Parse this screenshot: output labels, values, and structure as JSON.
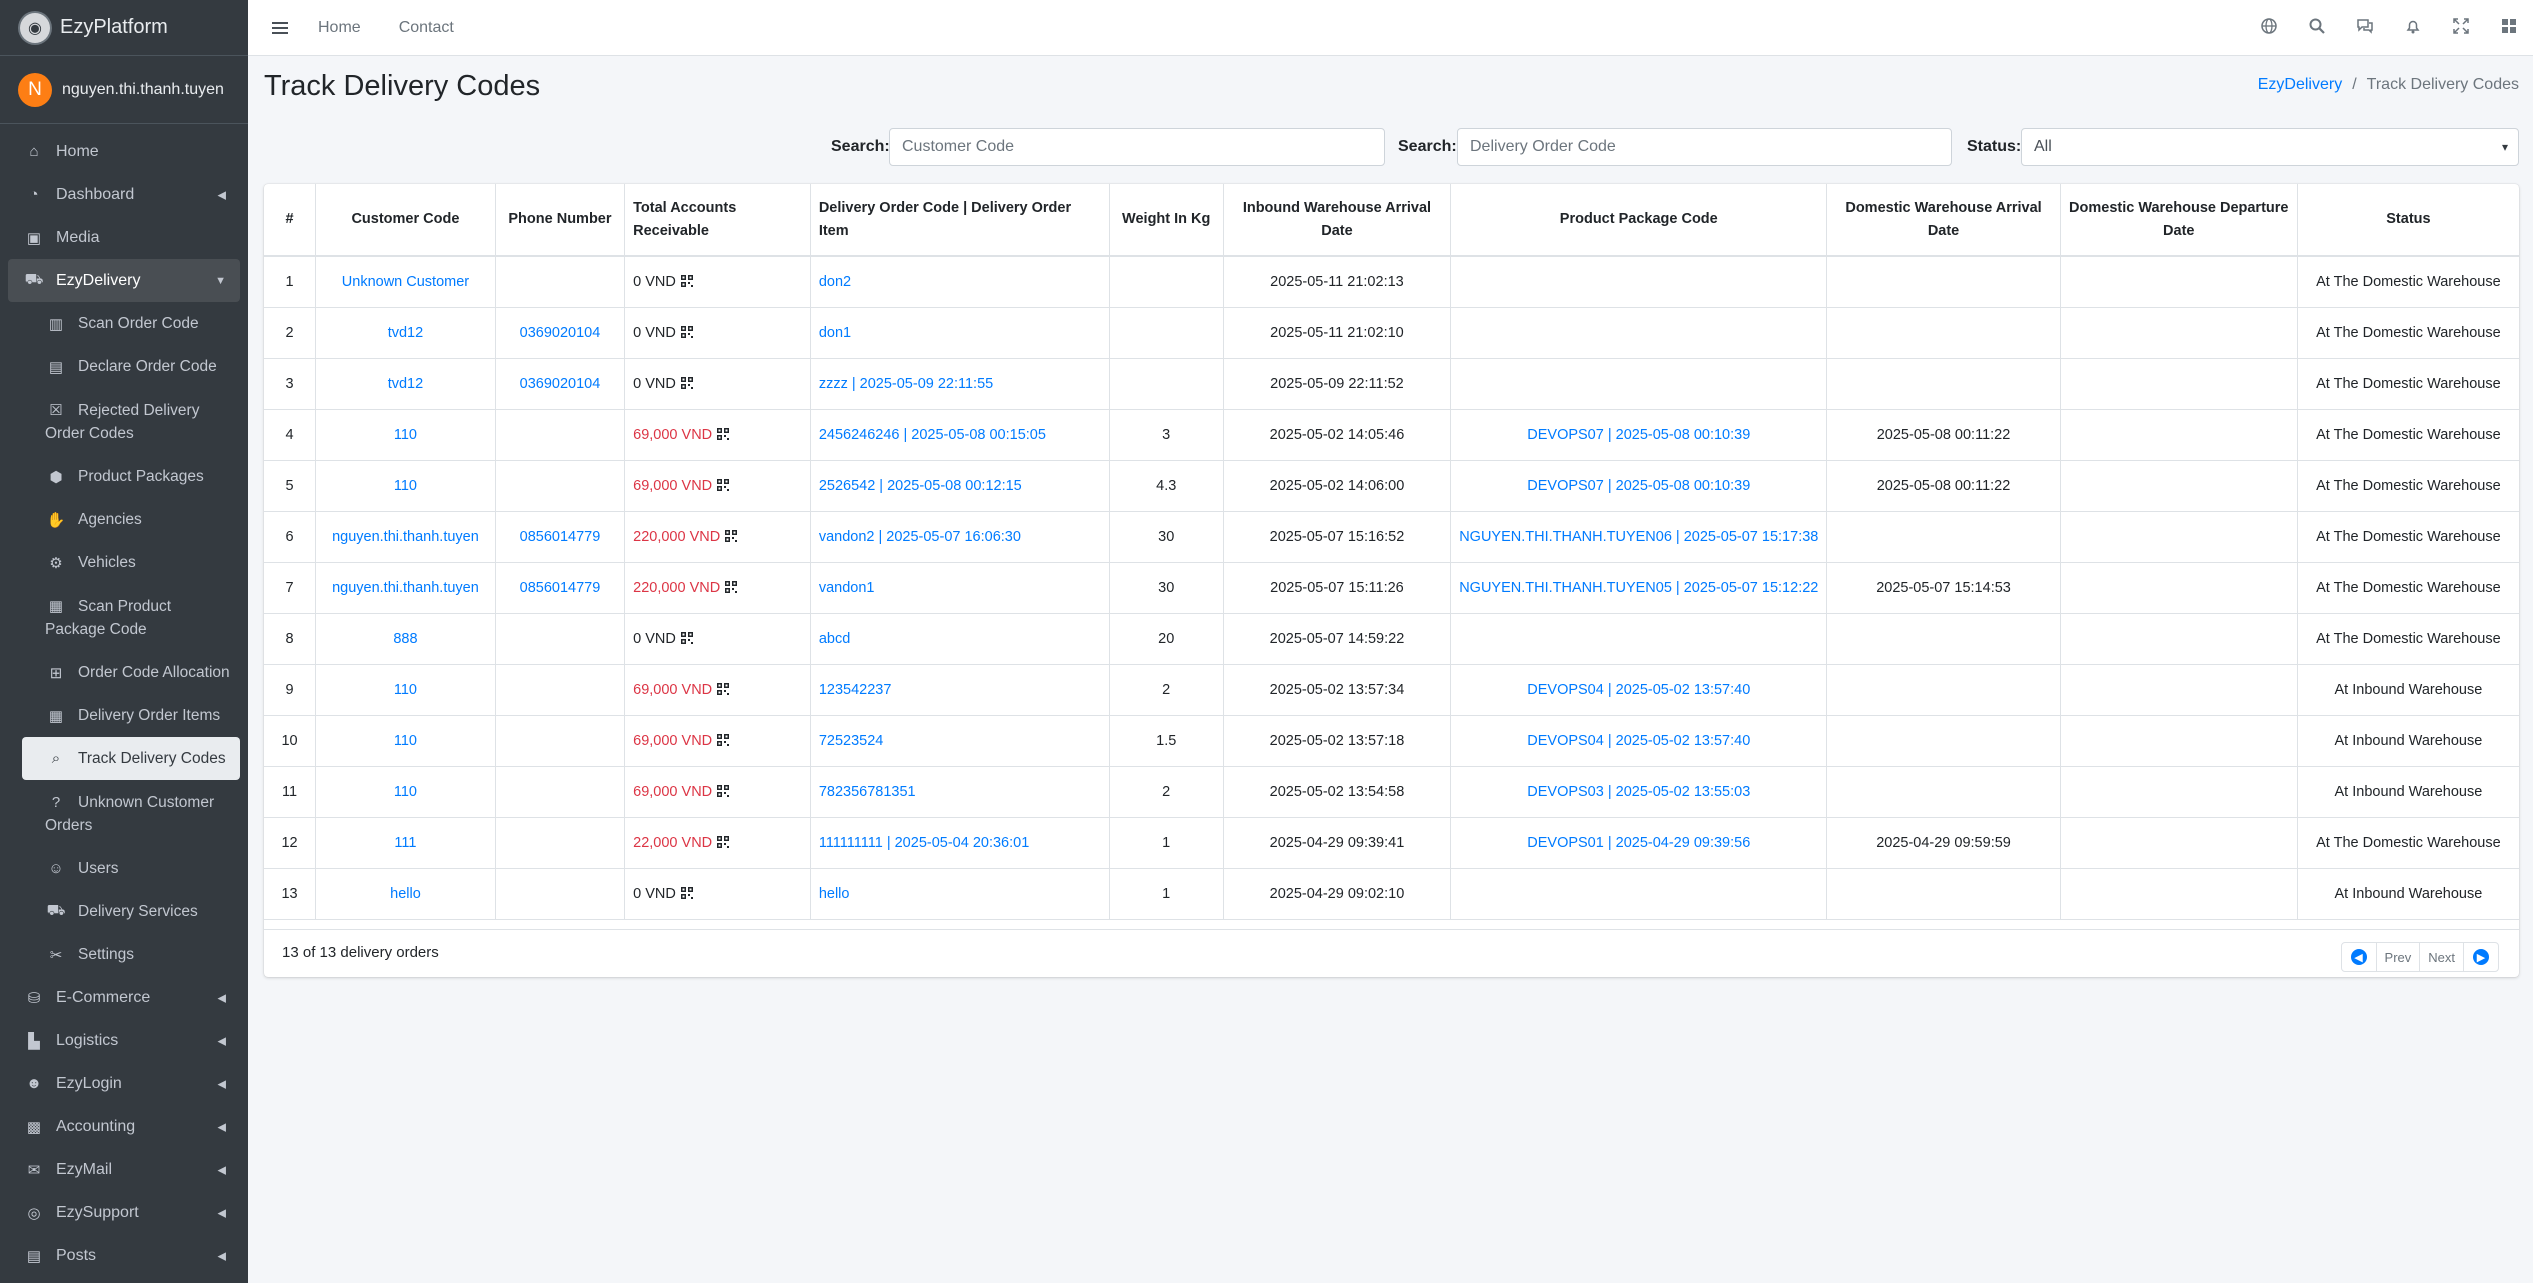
{
  "brand": {
    "name": "EzyPlatform"
  },
  "user": {
    "initial": "N",
    "name": "nguyen.thi.thanh.tuyen"
  },
  "sidebar": {
    "items_top": [
      {
        "label": "Home",
        "icon": "home-icon"
      },
      {
        "label": "Dashboard",
        "icon": "dashboard-icon"
      },
      {
        "label": "Media",
        "icon": "image-icon"
      },
      {
        "label": "EzyDelivery",
        "icon": "truck-icon"
      }
    ],
    "sub_items": [
      {
        "label": "Scan Order Code",
        "icon": "barcode-icon"
      },
      {
        "label": "Declare Order Code",
        "icon": "file-icon"
      },
      {
        "label": "Rejected Delivery Order Codes",
        "icon": "x-square-icon"
      },
      {
        "label": "Product Packages",
        "icon": "boxes-icon"
      },
      {
        "label": "Agencies",
        "icon": "handshake-icon"
      },
      {
        "label": "Vehicles",
        "icon": "motorcycle-icon"
      },
      {
        "label": "Scan Product Package Code",
        "icon": "qrcode-icon"
      },
      {
        "label": "Order Code Allocation",
        "icon": "sitemap-icon"
      },
      {
        "label": "Delivery Order Items",
        "icon": "grid-icon"
      },
      {
        "label": "Track Delivery Codes",
        "icon": "search-icon"
      },
      {
        "label": "Unknown Customer Orders",
        "icon": "question-icon"
      },
      {
        "label": "Users",
        "icon": "users-icon"
      },
      {
        "label": "Delivery Services",
        "icon": "truck-icon"
      },
      {
        "label": "Settings",
        "icon": "tools-icon"
      }
    ],
    "items_bottom": [
      {
        "label": "E-Commerce",
        "icon": "basket-icon"
      },
      {
        "label": "Logistics",
        "icon": "dolly-icon"
      },
      {
        "label": "EzyLogin",
        "icon": "user-lock-icon"
      },
      {
        "label": "Accounting",
        "icon": "calculator-icon"
      },
      {
        "label": "EzyMail",
        "icon": "envelope-icon"
      },
      {
        "label": "EzySupport",
        "icon": "support-icon"
      },
      {
        "label": "Posts",
        "icon": "newspaper-icon"
      }
    ]
  },
  "topbar": {
    "home": "Home",
    "contact": "Contact"
  },
  "page": {
    "title": "Track Delivery Codes"
  },
  "breadcrumb": {
    "parent": "EzyDelivery",
    "separator": "/",
    "current": "Track Delivery Codes"
  },
  "filters": {
    "search1_label": "Search:",
    "search1_placeholder": "Customer Code",
    "search2_label": "Search:",
    "search2_placeholder": "Delivery Order Code",
    "status_label": "Status:",
    "status_value": "All"
  },
  "table": {
    "headers": [
      "#",
      "Customer Code",
      "Phone Number",
      "Total Accounts Receivable",
      "Delivery Order Code | Delivery Order Item",
      "Weight In Kg",
      "Inbound Warehouse Arrival Date",
      "Product Package Code",
      "Domestic Warehouse Arrival Date",
      "Domestic Warehouse Departure Date",
      "Status"
    ],
    "rows": [
      [
        "1",
        "Unknown Customer",
        "",
        "0 VND",
        "don2",
        "",
        "2025-05-11 21:02:13",
        "",
        "",
        "",
        "At The Domestic Warehouse"
      ],
      [
        "2",
        "tvd12",
        "0369020104",
        "0 VND",
        "don1",
        "",
        "2025-05-11 21:02:10",
        "",
        "",
        "",
        "At The Domestic Warehouse"
      ],
      [
        "3",
        "tvd12",
        "0369020104",
        "0 VND",
        "zzzz | 2025-05-09 22:11:55",
        "",
        "2025-05-09 22:11:52",
        "",
        "",
        "",
        "At The Domestic Warehouse"
      ],
      [
        "4",
        "110",
        "",
        "69,000 VND",
        "2456246246 | 2025-05-08 00:15:05",
        "3",
        "2025-05-02 14:05:46",
        "DEVOPS07 | 2025-05-08 00:10:39",
        "2025-05-08 00:11:22",
        "",
        "At The Domestic Warehouse"
      ],
      [
        "5",
        "110",
        "",
        "69,000 VND",
        "2526542 | 2025-05-08 00:12:15",
        "4.3",
        "2025-05-02 14:06:00",
        "DEVOPS07 | 2025-05-08 00:10:39",
        "2025-05-08 00:11:22",
        "",
        "At The Domestic Warehouse"
      ],
      [
        "6",
        "nguyen.thi.thanh.tuyen",
        "0856014779",
        "220,000 VND",
        "vandon2 | 2025-05-07 16:06:30",
        "30",
        "2025-05-07 15:16:52",
        "NGUYEN.THI.THANH.TUYEN06 | 2025-05-07 15:17:38",
        "",
        "",
        "At The Domestic Warehouse"
      ],
      [
        "7",
        "nguyen.thi.thanh.tuyen",
        "0856014779",
        "220,000 VND",
        "vandon1",
        "30",
        "2025-05-07 15:11:26",
        "NGUYEN.THI.THANH.TUYEN05 | 2025-05-07 15:12:22",
        "2025-05-07 15:14:53",
        "",
        "At The Domestic Warehouse"
      ],
      [
        "8",
        "888",
        "",
        "0 VND",
        "abcd",
        "20",
        "2025-05-07 14:59:22",
        "",
        "",
        "",
        "At The Domestic Warehouse"
      ],
      [
        "9",
        "110",
        "",
        "69,000 VND",
        "123542237",
        "2",
        "2025-05-02 13:57:34",
        "DEVOPS04 | 2025-05-02 13:57:40",
        "",
        "",
        "At Inbound Warehouse"
      ],
      [
        "10",
        "110",
        "",
        "69,000 VND",
        "72523524",
        "1.5",
        "2025-05-02 13:57:18",
        "DEVOPS04 | 2025-05-02 13:57:40",
        "",
        "",
        "At Inbound Warehouse"
      ],
      [
        "11",
        "110",
        "",
        "69,000 VND",
        "782356781351",
        "2",
        "2025-05-02 13:54:58",
        "DEVOPS03 | 2025-05-02 13:55:03",
        "",
        "",
        "At Inbound Warehouse"
      ],
      [
        "12",
        "111",
        "",
        "22,000 VND",
        "111111111 | 2025-05-04 20:36:01",
        "1",
        "2025-04-29 09:39:41",
        "DEVOPS01 | 2025-04-29 09:39:56",
        "2025-04-29 09:59:59",
        "",
        "At The Domestic Warehouse"
      ],
      [
        "13",
        "hello",
        "",
        "0 VND",
        "hello",
        "1",
        "2025-04-29 09:02:10",
        "",
        "",
        "",
        "At Inbound Warehouse"
      ]
    ]
  },
  "footer": {
    "info": "13 of 13 delivery orders",
    "prev": "Prev",
    "next": "Next"
  },
  "colors": {
    "accent": "#007bff",
    "danger": "#dc3545",
    "sidebar": "#343a40"
  }
}
